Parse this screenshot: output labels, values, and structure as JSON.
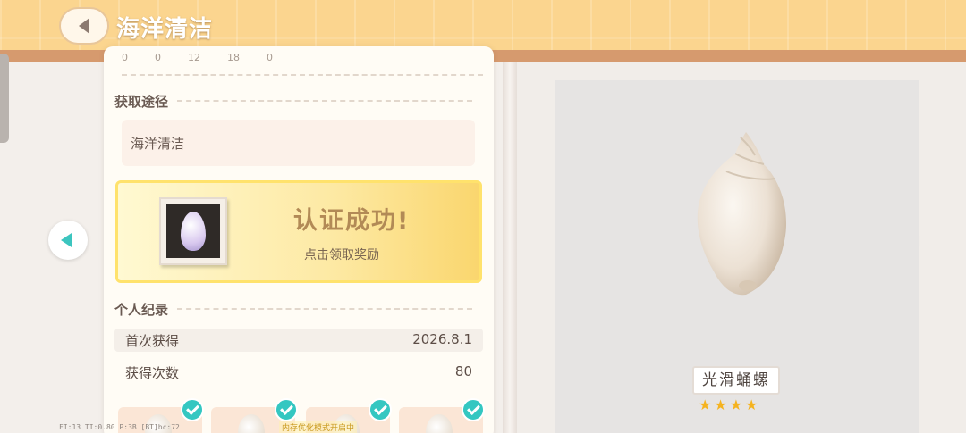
{
  "header": {
    "title": "海洋清洁",
    "back_icon": "chevron-left-icon"
  },
  "stats_top": [
    "0",
    "0",
    "12",
    "18",
    "0"
  ],
  "acquisition": {
    "section_title": "获取途径",
    "source": "海洋清洁"
  },
  "certification": {
    "title": "认证成功!",
    "subtitle": "点击领取奖励"
  },
  "personal_record": {
    "section_title": "个人纪录",
    "rows": [
      {
        "label": "首次获得",
        "value": "2026.8.1"
      },
      {
        "label": "获得次数",
        "value": "80"
      }
    ]
  },
  "item": {
    "name": "光滑蛹螺",
    "stars": 4,
    "star_glyph": "★"
  },
  "debug_overlay": "FI:13  TI:0.80  P:3B  [BT]bc:72",
  "memo_overlay": "内存优化模式开启中",
  "colors": {
    "banner": "#fbd58f",
    "accent_teal": "#3cc5bf",
    "cert_gold": "#ffe26c",
    "star": "#f5b31f"
  }
}
